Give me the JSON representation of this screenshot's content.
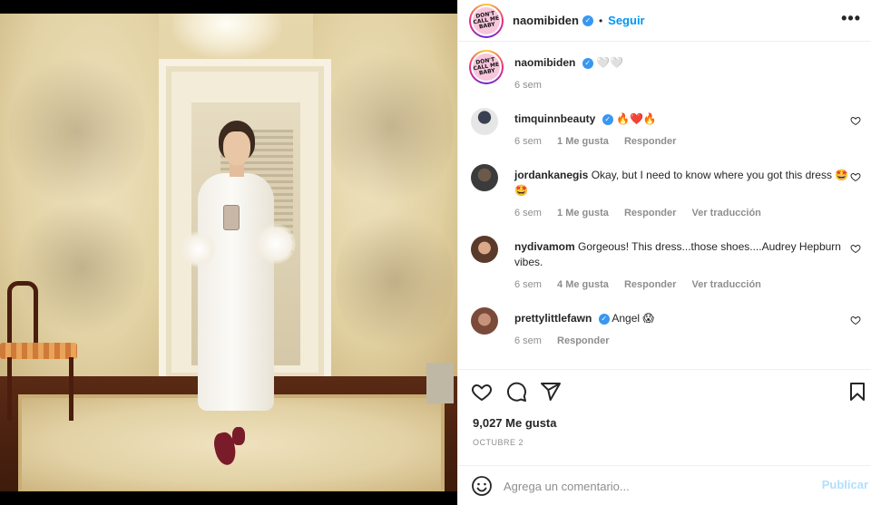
{
  "post": {
    "author": "naomibiden",
    "follow_label": "Seguir",
    "separator": "•",
    "more_label": "•••",
    "avatar_logo_text": "DON'T CALL ME BABY",
    "caption_text": "🤍🤍",
    "caption_time": "6 sem",
    "likes": "9,027 Me gusta",
    "date": "OCTUBRE 2"
  },
  "comments": [
    {
      "user": "timquinnbeauty",
      "verified": true,
      "text": "🔥❤️🔥",
      "time": "6 sem",
      "likes": "1 Me gusta",
      "reply": "Responder",
      "translate": ""
    },
    {
      "user": "jordankanegis",
      "verified": false,
      "text": "Okay, but I need to know where you got this dress 🤩🤩",
      "time": "6 sem",
      "likes": "1 Me gusta",
      "reply": "Responder",
      "translate": "Ver traducción"
    },
    {
      "user": "nydivamom",
      "verified": false,
      "text": "Gorgeous! This dress...those shoes....Audrey Hepburn vibes.",
      "time": "6 sem",
      "likes": "4 Me gusta",
      "reply": "Responder",
      "translate": "Ver traducción"
    },
    {
      "user": "prettylittlefawn",
      "verified": true,
      "text": "Angel 😱",
      "time": "6 sem",
      "likes": "",
      "reply": "Responder",
      "translate": ""
    }
  ],
  "composer": {
    "placeholder": "Agrega un comentario...",
    "publish_label": "Publicar"
  },
  "icons": {
    "like": "heart-icon",
    "comment": "comment-bubble-icon",
    "share": "paper-plane-icon",
    "save": "bookmark-icon",
    "more": "more-dots-icon",
    "emoji": "smiley-icon",
    "verified": "verified-badge-icon"
  },
  "colors": {
    "accent": "#0095f6",
    "verified": "#3897f0",
    "muted": "#8e8e8e",
    "publish_disabled": "#b2dffc"
  }
}
